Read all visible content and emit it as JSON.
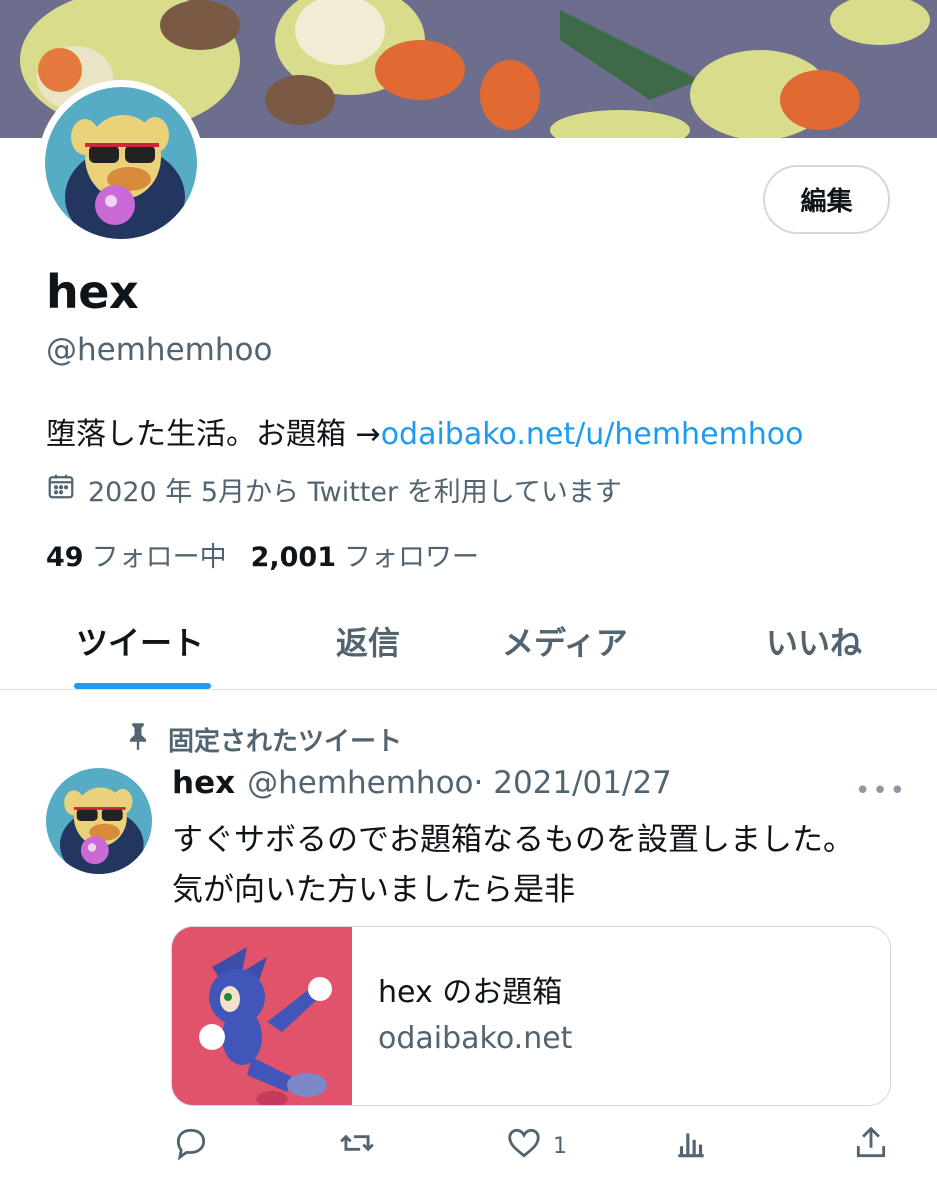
{
  "profile": {
    "display_name": "hex",
    "handle": "@hemhemhoo",
    "bio_text": "堕落した生活。お題箱 →",
    "bio_link": "odaibako.net/u/hemhemhoo",
    "joined": "2020 年 5月から Twitter を利用しています",
    "following_count": "49",
    "following_label": "フォロー中",
    "followers_count": "2,001",
    "followers_label": "フォロワー",
    "edit_label": "編集"
  },
  "tabs": [
    {
      "label": "ツイート",
      "active": true
    },
    {
      "label": "返信",
      "active": false
    },
    {
      "label": "メディア",
      "active": false
    },
    {
      "label": "いいね",
      "active": false
    }
  ],
  "pinned": {
    "label": "固定されたツイート",
    "tweet": {
      "name": "hex",
      "handle": "@hemhemhoo",
      "date": "· 2021/01/27",
      "more": "•••",
      "text": "すぐサボるのでお題箱なるものを設置しました。気が向いた方いましたら是非",
      "card_title": "hex のお題箱",
      "card_domain": "odaibako.net",
      "like_count": "1"
    }
  },
  "colors": {
    "accent": "#1d9bf0",
    "secondary_text": "#536471",
    "card_image_bg": "#e1536a",
    "banner_bg": "#6d6e8e"
  },
  "icons": [
    "calendar-icon",
    "pin-icon",
    "more-icon",
    "reply-icon",
    "retweet-icon",
    "like-icon",
    "analytics-icon",
    "share-icon"
  ]
}
